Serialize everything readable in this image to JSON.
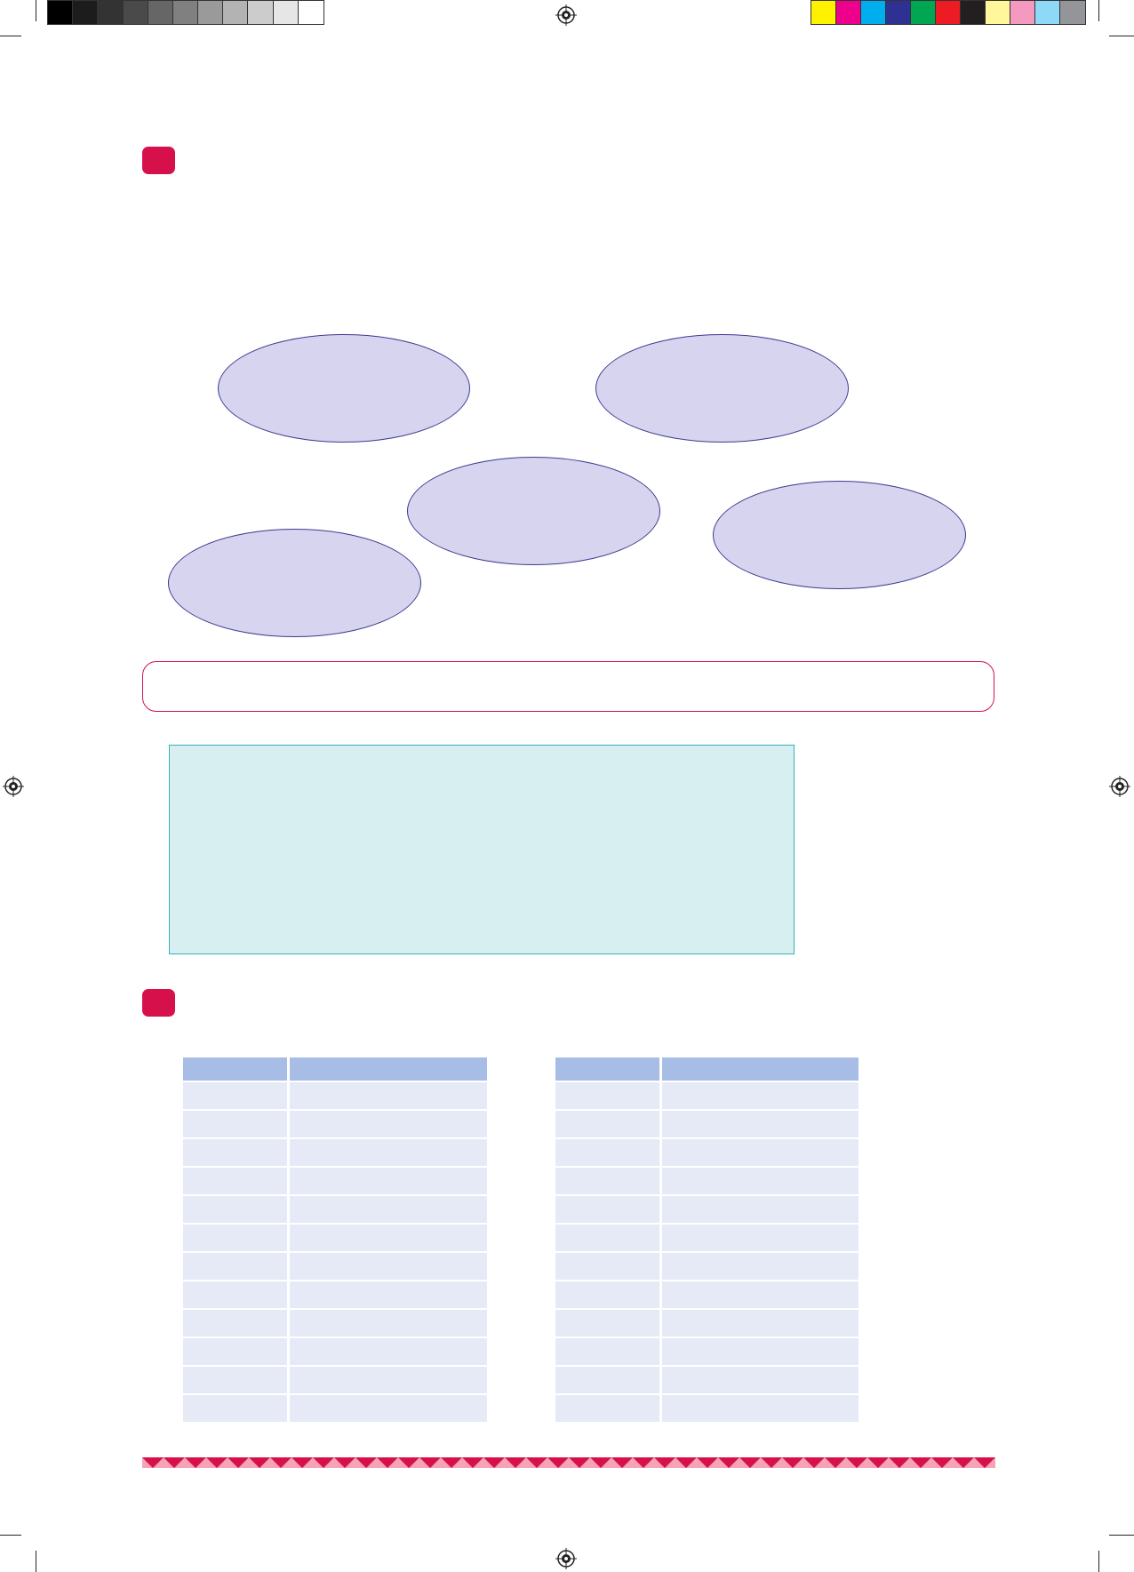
{
  "print_marks": {
    "grayscale_swatches": [
      "#000000",
      "#1c1c1c",
      "#333333",
      "#4a4a4a",
      "#666666",
      "#808080",
      "#9a9a9a",
      "#b3b3b3",
      "#cccccc",
      "#e6e6e6",
      "#ffffff"
    ],
    "color_swatches": [
      "#fff200",
      "#ec008c",
      "#00aeef",
      "#2e3192",
      "#00a651",
      "#ed1c24",
      "#231f20",
      "#fff799",
      "#f49ac1",
      "#8ed8f8",
      "#939598"
    ]
  },
  "colors": {
    "marker": "#d6104a",
    "ellipse_fill": "#d6d4ee",
    "info_box_fill": "#d7eff0",
    "table_header": "#a7bde6",
    "table_row": "#e6eaf6"
  },
  "section_markers": [
    "activity-1-marker",
    "activity-2-marker"
  ],
  "ellipses": [
    {
      "name": "ellipse-top-left"
    },
    {
      "name": "ellipse-top-right"
    },
    {
      "name": "ellipse-middle"
    },
    {
      "name": "ellipse-right"
    },
    {
      "name": "ellipse-bottom-left"
    }
  ],
  "tables": {
    "left": {
      "header": [
        "",
        ""
      ],
      "rows": [
        [
          "",
          ""
        ],
        [
          "",
          ""
        ],
        [
          "",
          ""
        ],
        [
          "",
          ""
        ],
        [
          "",
          ""
        ],
        [
          "",
          ""
        ],
        [
          "",
          ""
        ],
        [
          "",
          ""
        ],
        [
          "",
          ""
        ],
        [
          "",
          ""
        ],
        [
          "",
          ""
        ],
        [
          "",
          ""
        ]
      ]
    },
    "right": {
      "header": [
        "",
        ""
      ],
      "rows": [
        [
          "",
          ""
        ],
        [
          "",
          ""
        ],
        [
          "",
          ""
        ],
        [
          "",
          ""
        ],
        [
          "",
          ""
        ],
        [
          "",
          ""
        ],
        [
          "",
          ""
        ],
        [
          "",
          ""
        ],
        [
          "",
          ""
        ],
        [
          "",
          ""
        ],
        [
          "",
          ""
        ],
        [
          "",
          ""
        ]
      ]
    }
  }
}
